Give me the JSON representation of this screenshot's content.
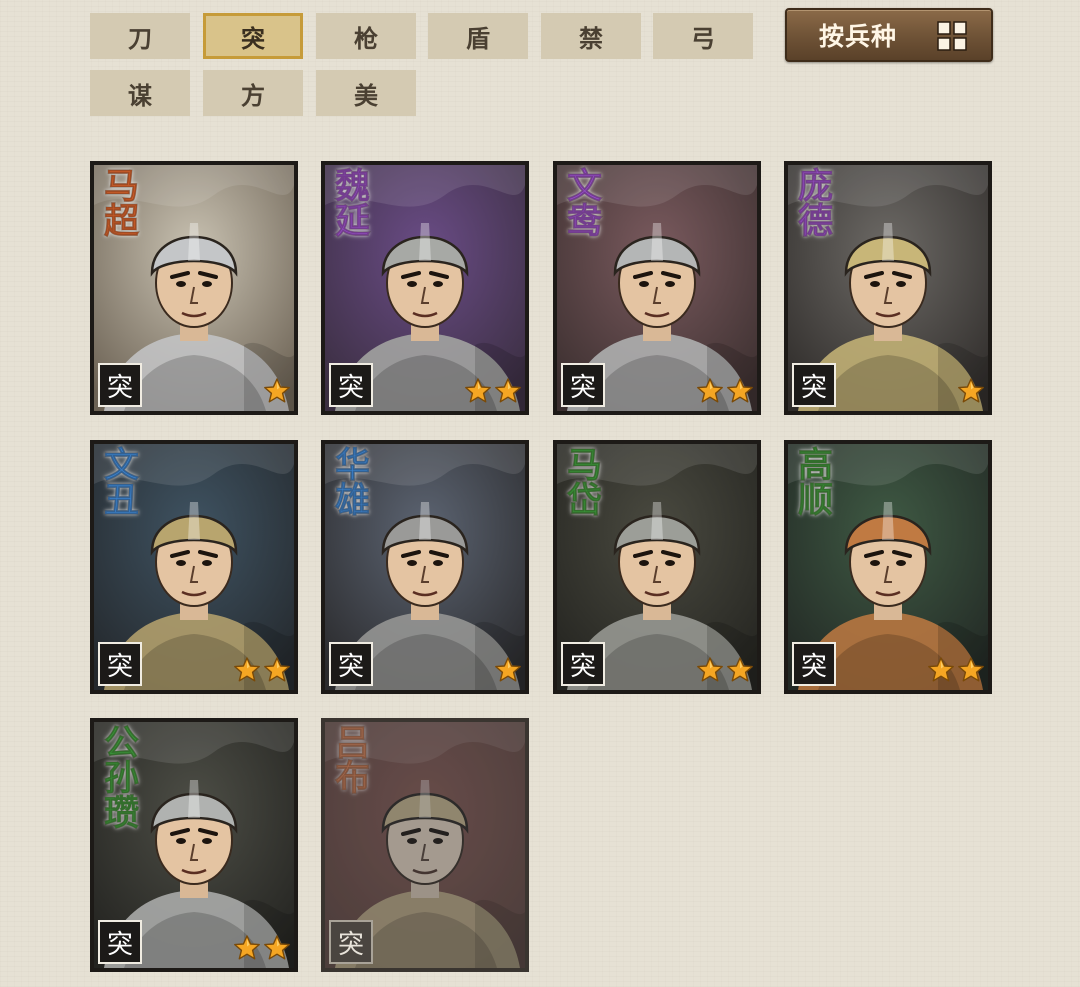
{
  "tabs": [
    {
      "label": "刀",
      "active": false
    },
    {
      "label": "突",
      "active": true
    },
    {
      "label": "枪",
      "active": false
    },
    {
      "label": "盾",
      "active": false
    },
    {
      "label": "禁",
      "active": false
    },
    {
      "label": "弓",
      "active": false
    },
    {
      "label": "谋",
      "active": false
    },
    {
      "label": "方",
      "active": false
    },
    {
      "label": "美",
      "active": false
    }
  ],
  "sort_button": {
    "label": "按兵种",
    "icon": "grid-icon"
  },
  "generals": [
    {
      "name": "马超",
      "name_color": "#e0642b",
      "type": "突",
      "stars": 1,
      "bg": "#c9c2b2",
      "bg2": "#6c6254",
      "armor": "#c4c6c8",
      "locked": false
    },
    {
      "name": "魏延",
      "name_color": "#9b4fd0",
      "type": "突",
      "stars": 2,
      "bg": "#6a4c86",
      "bg2": "#3a2e40",
      "armor": "#a7a9a5",
      "locked": false
    },
    {
      "name": "文鸯",
      "name_color": "#9b4fd0",
      "type": "突",
      "stars": 2,
      "bg": "#7a5a5e",
      "bg2": "#3b2f2f",
      "armor": "#b4b6b6",
      "locked": false
    },
    {
      "name": "庞德",
      "name_color": "#9b4fd0",
      "type": "突",
      "stars": 1,
      "bg": "#6d6a66",
      "bg2": "#2f2c2a",
      "armor": "#c8b678",
      "locked": false
    },
    {
      "name": "文丑",
      "name_color": "#3a86d6",
      "type": "突",
      "stars": 2,
      "bg": "#3f5362",
      "bg2": "#24282c",
      "armor": "#b8a56e",
      "locked": false
    },
    {
      "name": "华雄",
      "name_color": "#3a86d6",
      "type": "突",
      "stars": 1,
      "bg": "#5c6472",
      "bg2": "#2a2a2c",
      "armor": "#9a9a98",
      "locked": false
    },
    {
      "name": "马岱",
      "name_color": "#3a9a3a",
      "type": "突",
      "stars": 2,
      "bg": "#4a4a40",
      "bg2": "#242420",
      "armor": "#9c9e98",
      "locked": false
    },
    {
      "name": "高顺",
      "name_color": "#3a9a3a",
      "type": "突",
      "stars": 2,
      "bg": "#3f5a44",
      "bg2": "#222824",
      "armor": "#c07a42",
      "locked": false
    },
    {
      "name": "公孙瓒",
      "name_color": "#3a9a3a",
      "type": "突",
      "stars": 2,
      "bg": "#4d4e46",
      "bg2": "#232320",
      "armor": "#b0b2b0",
      "locked": false
    },
    {
      "name": "吕布",
      "name_color": "#c87a52",
      "type": "突",
      "stars": 0,
      "bg": "#a24a42",
      "bg2": "#6a3a32",
      "armor": "#c8aa5a",
      "locked": true
    }
  ]
}
